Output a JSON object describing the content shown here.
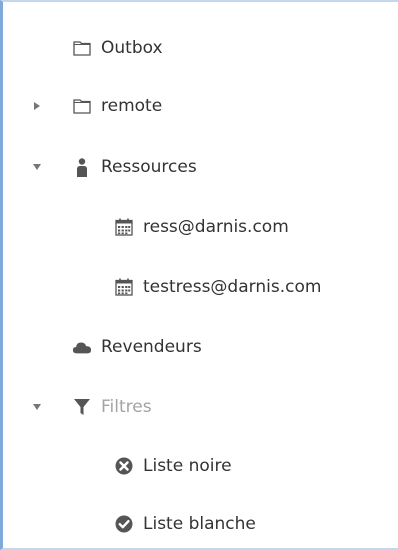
{
  "colors": {
    "text": "#333333",
    "muted_text": "#a3a3a3",
    "icon": "#555555",
    "toggle": "#777777",
    "accent_border": "#7ea9d9"
  },
  "tree": {
    "items": [
      {
        "label": "Outbox",
        "icon": "folder-icon",
        "expander": "none"
      },
      {
        "label": "remote",
        "icon": "folder-icon",
        "expander": "collapsed"
      },
      {
        "label": "Ressources",
        "icon": "person-icon",
        "expander": "expanded"
      },
      {
        "label": "ress@darnis.com",
        "icon": "calendar-icon",
        "expander": "none"
      },
      {
        "label": "testress@darnis.com",
        "icon": "calendar-icon",
        "expander": "none"
      },
      {
        "label": "Revendeurs",
        "icon": "cloud-icon",
        "expander": "none"
      },
      {
        "label": "Filtres",
        "icon": "filter-icon",
        "expander": "expanded",
        "muted": true
      },
      {
        "label": "Liste noire",
        "icon": "x-circle-icon",
        "expander": "none"
      },
      {
        "label": "Liste blanche",
        "icon": "check-circle-icon",
        "expander": "none"
      }
    ]
  }
}
